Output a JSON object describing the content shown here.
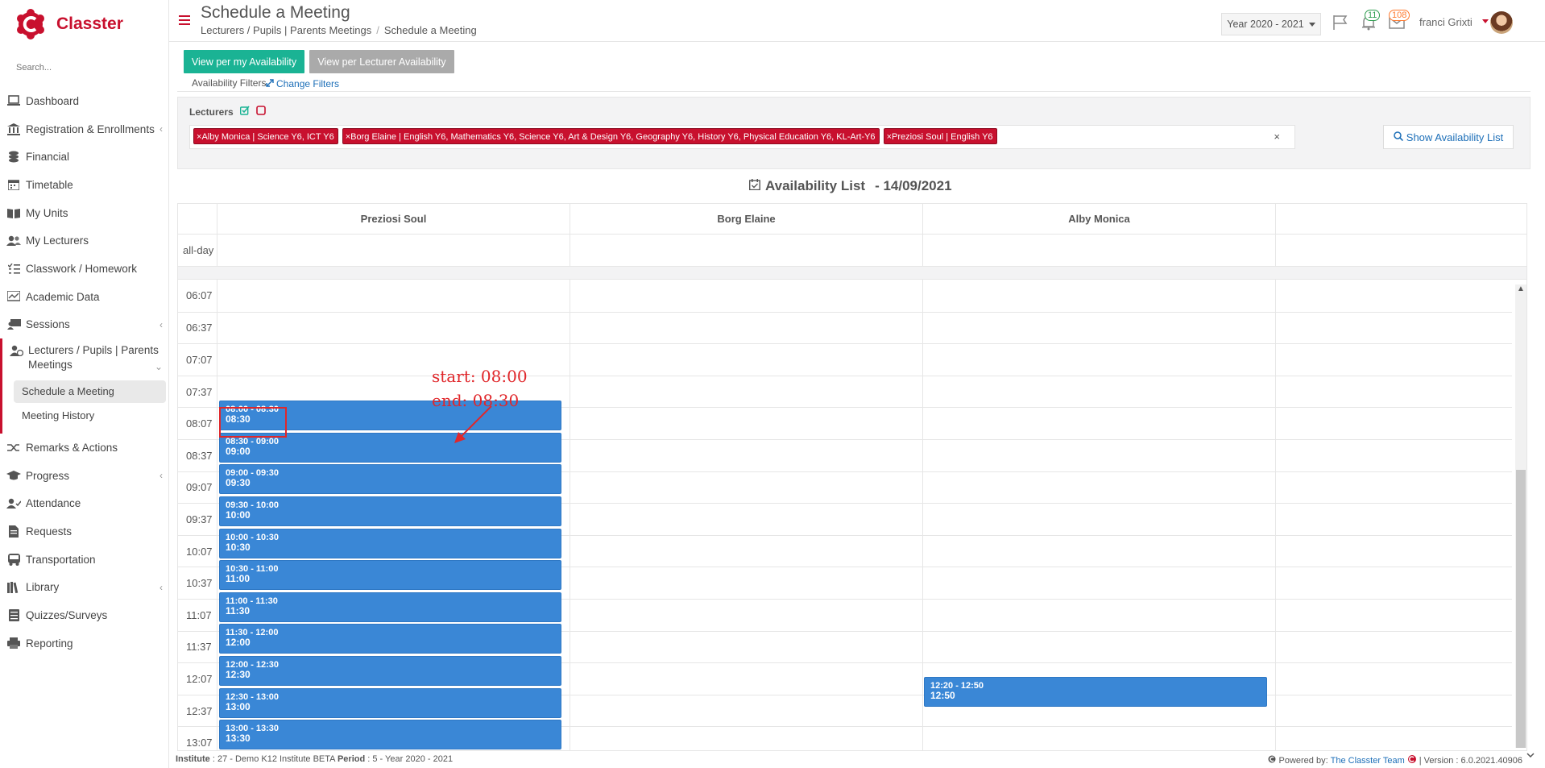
{
  "app": {
    "brand": "Classter",
    "search_placeholder": "Search..."
  },
  "sidebar": {
    "items": [
      {
        "label": "Dashboard",
        "icon": "laptop-icon"
      },
      {
        "label": "Registration & Enrollments",
        "icon": "bank-icon"
      },
      {
        "label": "Financial",
        "icon": "coins-icon"
      },
      {
        "label": "Timetable",
        "icon": "calendar-icon"
      },
      {
        "label": "My Units",
        "icon": "book-icon"
      },
      {
        "label": "My Lecturers",
        "icon": "users-icon"
      },
      {
        "label": "Classwork / Homework",
        "icon": "tasks-icon"
      },
      {
        "label": "Academic Data",
        "icon": "chart-icon"
      },
      {
        "label": "Sessions",
        "icon": "sessions-icon"
      },
      {
        "label": "Lecturers / Pupils | Parents Meetings",
        "icon": "meeting-icon"
      },
      {
        "label": "Remarks & Actions",
        "icon": "shuffle-icon"
      },
      {
        "label": "Progress",
        "icon": "graduation-icon"
      },
      {
        "label": "Attendance",
        "icon": "user-check-icon"
      },
      {
        "label": "Requests",
        "icon": "document-icon"
      },
      {
        "label": "Transportation",
        "icon": "bus-icon"
      },
      {
        "label": "Library",
        "icon": "library-icon"
      },
      {
        "label": "Quizzes/Surveys",
        "icon": "list-icon"
      },
      {
        "label": "Reporting",
        "icon": "printer-icon"
      }
    ],
    "sub_items": [
      "Schedule a Meeting",
      "Meeting History"
    ]
  },
  "header": {
    "title": "Schedule a Meeting",
    "breadcrumb": [
      "Lecturers / Pupils | Parents Meetings",
      "Schedule a Meeting"
    ],
    "year": "Year 2020 - 2021",
    "notifications_count": "11",
    "messages_count": "108",
    "user_name": "franci Grixti"
  },
  "toolbar": {
    "view_my": "View per my Availability",
    "view_lecturer": "View per Lecturer Availability"
  },
  "filters": {
    "label": "Availability Filters",
    "change": "Change Filters",
    "lecturers_label": "Lecturers",
    "tags": [
      "Alby Monica | Science Y6, ICT Y6",
      "Borg Elaine | English Y6, Mathematics Y6, Science Y6, Art & Design Y6, Geography Y6, History Y6, Physical Education Y6, KL-Art-Y6",
      "Preziosi Soul | English Y6"
    ],
    "clear": "×",
    "show_list": "Show Availability List"
  },
  "availability": {
    "title": "Availability List",
    "date": "- 14/09/2021",
    "columns": [
      "Preziosi Soul",
      "Borg Elaine",
      "Alby Monica"
    ],
    "allday_label": "all-day",
    "times": [
      "06:07",
      "06:37",
      "07:07",
      "07:37",
      "08:07",
      "08:37",
      "09:07",
      "09:37",
      "10:07",
      "10:37",
      "11:07",
      "11:37",
      "12:07",
      "12:37",
      "13:07"
    ],
    "events_col1": [
      {
        "range": "08:00 - 08:30",
        "end": "08:30"
      },
      {
        "range": "08:30 - 09:00",
        "end": "09:00"
      },
      {
        "range": "09:00 - 09:30",
        "end": "09:30"
      },
      {
        "range": "09:30 - 10:00",
        "end": "10:00"
      },
      {
        "range": "10:00 - 10:30",
        "end": "10:30"
      },
      {
        "range": "10:30 - 11:00",
        "end": "11:00"
      },
      {
        "range": "11:00 - 11:30",
        "end": "11:30"
      },
      {
        "range": "11:30 - 12:00",
        "end": "12:00"
      },
      {
        "range": "12:00 - 12:30",
        "end": "12:30"
      },
      {
        "range": "12:30 - 13:00",
        "end": "13:00"
      },
      {
        "range": "13:00 - 13:30",
        "end": "13:30"
      }
    ],
    "events_col3": [
      {
        "range": "12:20 - 12:50",
        "end": "12:50"
      }
    ]
  },
  "annotation": {
    "line1": "start: 08:00",
    "line2": "end: 08:30",
    "color": "#e0272b"
  },
  "footer": {
    "institute_label": "Institute",
    "institute_value": ": 27 - Demo K12 Institute BETA",
    "period_label": "Period",
    "period_value": ": 5 - Year 2020 - 2021",
    "powered_by": "Powered by:",
    "team": "The Classter Team",
    "version": "| Version : 6.0.2021.40906"
  },
  "colors": {
    "brand": "#c8102e",
    "primary_button": "#1ab394",
    "event": "#3a87d6",
    "link": "#1d6fb8"
  }
}
